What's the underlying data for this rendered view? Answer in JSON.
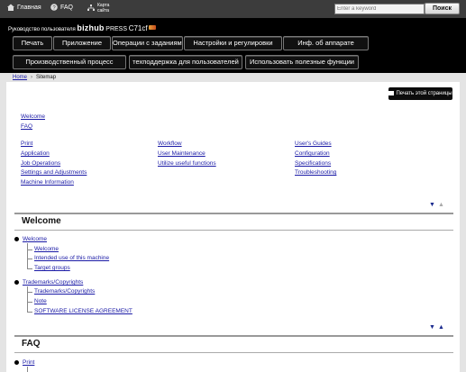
{
  "topbar": {
    "home": "Главная",
    "faq": "FAQ",
    "sitemap_line1": "Карта",
    "sitemap_line2": "сайта",
    "search_placeholder": "Enter a keyword",
    "search_button": "Поиск"
  },
  "brand": {
    "prefix": "Руководство пользователя",
    "product": "bizhub",
    "press": "PRESS",
    "model": "C71cf"
  },
  "nav_row1": [
    "Печать",
    "Приложение",
    "Операции с заданиями",
    "Настройки и регулировки",
    "Инф. об аппарате"
  ],
  "nav_row2": [
    "Производственный процесс",
    "техподдержка для пользователей",
    "Использовать полезные функции"
  ],
  "breadcrumb": {
    "home": "Home",
    "current": "Sitemap"
  },
  "print_button": "Печать этой страницы",
  "top_links": [
    "Welcome",
    "FAQ"
  ],
  "columns": {
    "col1": [
      "Print",
      "Application",
      "Job Operations",
      "Settings and Adjustments",
      "Machine Information"
    ],
    "col2": [
      "Workflow",
      "User Maintenance",
      "Utilize useful functions"
    ],
    "col3": [
      "User's Guides",
      "Configuration",
      "Specifications",
      "Troubleshooting"
    ]
  },
  "arrow_down": "▼",
  "arrow_up": "▲",
  "welcome_section": {
    "title": "Welcome",
    "groups": [
      {
        "label": "Welcome",
        "children": [
          "Welcome",
          "Intended use of this machine",
          "Target groups"
        ]
      },
      {
        "label": "Trademarks/Copyrights",
        "children": [
          "Trademarks/Copyrights",
          "Note",
          "SOFTWARE LICENSE AGREEMENT"
        ]
      }
    ]
  },
  "faq_section": {
    "title": "FAQ",
    "groups": [
      {
        "label": "Print"
      }
    ]
  },
  "colors": {
    "link": "#1a1aa6",
    "header_bg": "#000000",
    "topbar_bg": "#3c3c3c"
  },
  "icons": {
    "home": "home-icon",
    "faq": "question-icon",
    "sitemap": "sitemap-icon",
    "print": "printer-icon"
  }
}
